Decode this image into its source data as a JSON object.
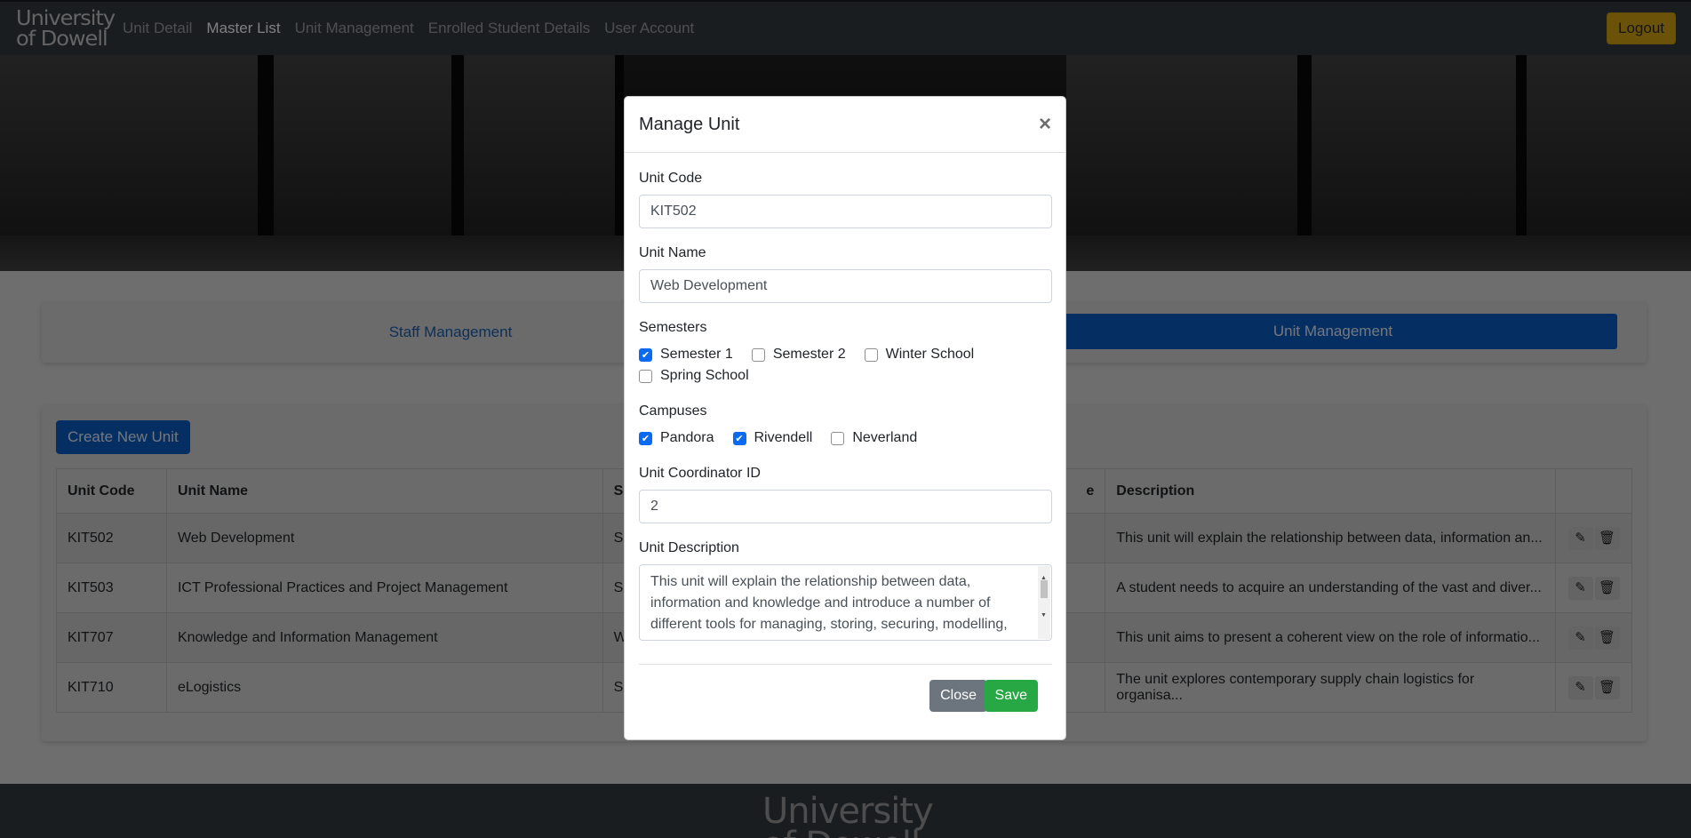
{
  "navbar": {
    "brand_line1": "University",
    "brand_line2": "of Dowell",
    "links": [
      "Unit Detail",
      "Master List",
      "Unit Management",
      "Enrolled Student Details",
      "User Account"
    ],
    "active_link": "Master List",
    "logout_label": "Logout"
  },
  "tabs": {
    "staff": "Staff Management",
    "unit": "Unit Management",
    "active": "Unit Management"
  },
  "units": {
    "create_label": "Create New Unit",
    "columns": [
      "Unit Code",
      "Unit Name",
      "S",
      "e",
      "Description"
    ],
    "rows": [
      {
        "code": "KIT502",
        "name": "Web Development",
        "s": "S",
        "description": "This unit will explain the relationship between data, information an..."
      },
      {
        "code": "KIT503",
        "name": "ICT Professional Practices and Project Management",
        "s": "S",
        "description": "A student needs to acquire an understanding of the vast and diver..."
      },
      {
        "code": "KIT707",
        "name": "Knowledge and Information Management",
        "s": "W",
        "description": "This unit aims to present a coherent view on the role of informatio..."
      },
      {
        "code": "KIT710",
        "name": "eLogistics",
        "s": "S",
        "description": "The unit explores contemporary supply chain logistics for organisa..."
      }
    ],
    "edit_icon": "pencil-icon",
    "delete_icon": "trash-icon"
  },
  "footer": {
    "logo_line1": "University",
    "logo_line2": "of Dowell"
  },
  "modal": {
    "title": "Manage Unit",
    "close_icon": "close-icon",
    "unit_code_label": "Unit Code",
    "unit_code_value": "KIT502",
    "unit_name_label": "Unit Name",
    "unit_name_value": "Web Development",
    "semesters_label": "Semesters",
    "semesters": [
      {
        "label": "Semester 1",
        "checked": true
      },
      {
        "label": "Semester 2",
        "checked": false
      },
      {
        "label": "Winter School",
        "checked": false
      },
      {
        "label": "Spring School",
        "checked": false
      }
    ],
    "campuses_label": "Campuses",
    "campuses": [
      {
        "label": "Pandora",
        "checked": true
      },
      {
        "label": "Rivendell",
        "checked": true
      },
      {
        "label": "Neverland",
        "checked": false
      }
    ],
    "coordinator_label": "Unit Coordinator ID",
    "coordinator_value": "2",
    "description_label": "Unit Description",
    "description_value": "This unit will explain the relationship between data, information and knowledge and introduce a number of different tools for managing, storing, securing, modelling,",
    "close_label": "Close",
    "save_label": "Save"
  },
  "colors": {
    "navbar": "#343a40",
    "primary": "#0b5ec7",
    "logout": "#d4a712",
    "save": "#28a745",
    "close": "#6c757d"
  }
}
